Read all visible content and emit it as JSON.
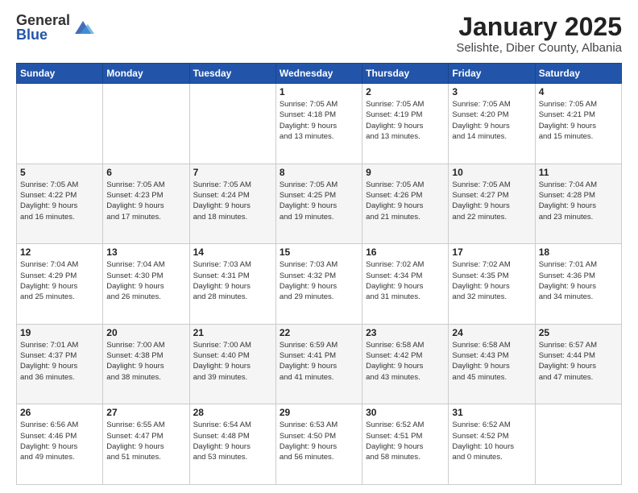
{
  "header": {
    "logo_general": "General",
    "logo_blue": "Blue",
    "title": "January 2025",
    "subtitle": "Selishte, Diber County, Albania"
  },
  "weekdays": [
    "Sunday",
    "Monday",
    "Tuesday",
    "Wednesday",
    "Thursday",
    "Friday",
    "Saturday"
  ],
  "weeks": [
    [
      {
        "day": "",
        "info": ""
      },
      {
        "day": "",
        "info": ""
      },
      {
        "day": "",
        "info": ""
      },
      {
        "day": "1",
        "info": "Sunrise: 7:05 AM\nSunset: 4:18 PM\nDaylight: 9 hours\nand 13 minutes."
      },
      {
        "day": "2",
        "info": "Sunrise: 7:05 AM\nSunset: 4:19 PM\nDaylight: 9 hours\nand 13 minutes."
      },
      {
        "day": "3",
        "info": "Sunrise: 7:05 AM\nSunset: 4:20 PM\nDaylight: 9 hours\nand 14 minutes."
      },
      {
        "day": "4",
        "info": "Sunrise: 7:05 AM\nSunset: 4:21 PM\nDaylight: 9 hours\nand 15 minutes."
      }
    ],
    [
      {
        "day": "5",
        "info": "Sunrise: 7:05 AM\nSunset: 4:22 PM\nDaylight: 9 hours\nand 16 minutes."
      },
      {
        "day": "6",
        "info": "Sunrise: 7:05 AM\nSunset: 4:23 PM\nDaylight: 9 hours\nand 17 minutes."
      },
      {
        "day": "7",
        "info": "Sunrise: 7:05 AM\nSunset: 4:24 PM\nDaylight: 9 hours\nand 18 minutes."
      },
      {
        "day": "8",
        "info": "Sunrise: 7:05 AM\nSunset: 4:25 PM\nDaylight: 9 hours\nand 19 minutes."
      },
      {
        "day": "9",
        "info": "Sunrise: 7:05 AM\nSunset: 4:26 PM\nDaylight: 9 hours\nand 21 minutes."
      },
      {
        "day": "10",
        "info": "Sunrise: 7:05 AM\nSunset: 4:27 PM\nDaylight: 9 hours\nand 22 minutes."
      },
      {
        "day": "11",
        "info": "Sunrise: 7:04 AM\nSunset: 4:28 PM\nDaylight: 9 hours\nand 23 minutes."
      }
    ],
    [
      {
        "day": "12",
        "info": "Sunrise: 7:04 AM\nSunset: 4:29 PM\nDaylight: 9 hours\nand 25 minutes."
      },
      {
        "day": "13",
        "info": "Sunrise: 7:04 AM\nSunset: 4:30 PM\nDaylight: 9 hours\nand 26 minutes."
      },
      {
        "day": "14",
        "info": "Sunrise: 7:03 AM\nSunset: 4:31 PM\nDaylight: 9 hours\nand 28 minutes."
      },
      {
        "day": "15",
        "info": "Sunrise: 7:03 AM\nSunset: 4:32 PM\nDaylight: 9 hours\nand 29 minutes."
      },
      {
        "day": "16",
        "info": "Sunrise: 7:02 AM\nSunset: 4:34 PM\nDaylight: 9 hours\nand 31 minutes."
      },
      {
        "day": "17",
        "info": "Sunrise: 7:02 AM\nSunset: 4:35 PM\nDaylight: 9 hours\nand 32 minutes."
      },
      {
        "day": "18",
        "info": "Sunrise: 7:01 AM\nSunset: 4:36 PM\nDaylight: 9 hours\nand 34 minutes."
      }
    ],
    [
      {
        "day": "19",
        "info": "Sunrise: 7:01 AM\nSunset: 4:37 PM\nDaylight: 9 hours\nand 36 minutes."
      },
      {
        "day": "20",
        "info": "Sunrise: 7:00 AM\nSunset: 4:38 PM\nDaylight: 9 hours\nand 38 minutes."
      },
      {
        "day": "21",
        "info": "Sunrise: 7:00 AM\nSunset: 4:40 PM\nDaylight: 9 hours\nand 39 minutes."
      },
      {
        "day": "22",
        "info": "Sunrise: 6:59 AM\nSunset: 4:41 PM\nDaylight: 9 hours\nand 41 minutes."
      },
      {
        "day": "23",
        "info": "Sunrise: 6:58 AM\nSunset: 4:42 PM\nDaylight: 9 hours\nand 43 minutes."
      },
      {
        "day": "24",
        "info": "Sunrise: 6:58 AM\nSunset: 4:43 PM\nDaylight: 9 hours\nand 45 minutes."
      },
      {
        "day": "25",
        "info": "Sunrise: 6:57 AM\nSunset: 4:44 PM\nDaylight: 9 hours\nand 47 minutes."
      }
    ],
    [
      {
        "day": "26",
        "info": "Sunrise: 6:56 AM\nSunset: 4:46 PM\nDaylight: 9 hours\nand 49 minutes."
      },
      {
        "day": "27",
        "info": "Sunrise: 6:55 AM\nSunset: 4:47 PM\nDaylight: 9 hours\nand 51 minutes."
      },
      {
        "day": "28",
        "info": "Sunrise: 6:54 AM\nSunset: 4:48 PM\nDaylight: 9 hours\nand 53 minutes."
      },
      {
        "day": "29",
        "info": "Sunrise: 6:53 AM\nSunset: 4:50 PM\nDaylight: 9 hours\nand 56 minutes."
      },
      {
        "day": "30",
        "info": "Sunrise: 6:52 AM\nSunset: 4:51 PM\nDaylight: 9 hours\nand 58 minutes."
      },
      {
        "day": "31",
        "info": "Sunrise: 6:52 AM\nSunset: 4:52 PM\nDaylight: 10 hours\nand 0 minutes."
      },
      {
        "day": "",
        "info": ""
      }
    ]
  ]
}
